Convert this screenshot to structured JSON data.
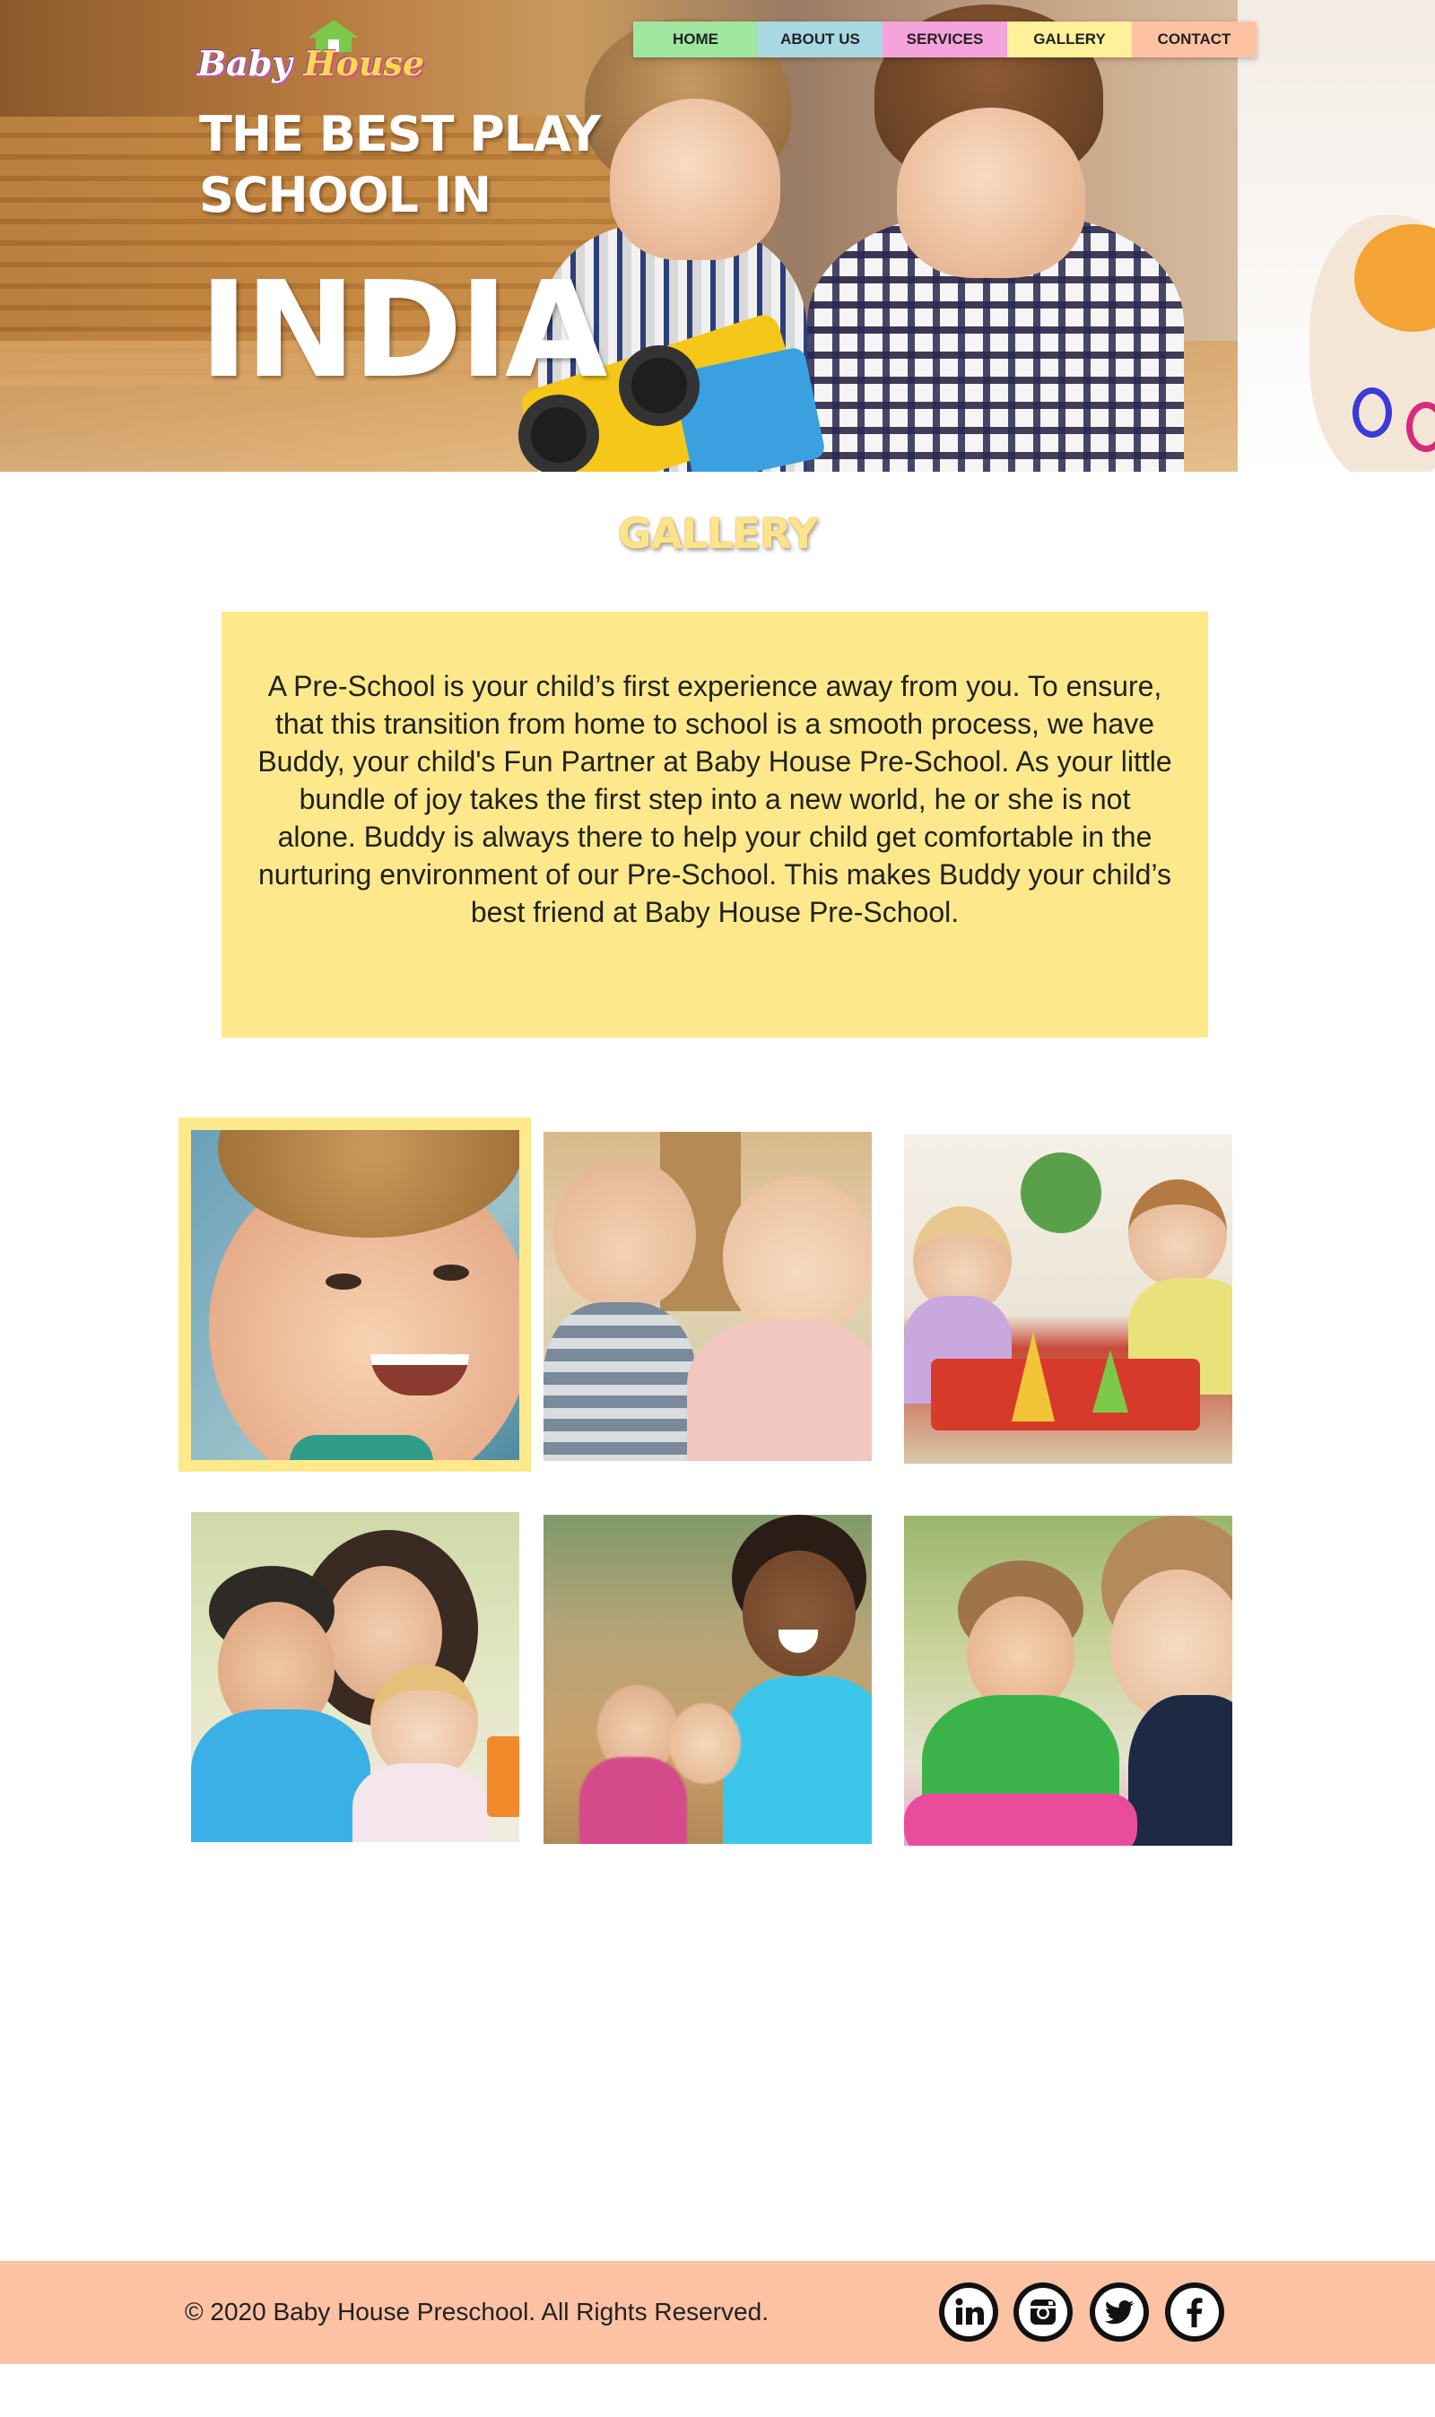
{
  "logo": {
    "word1": "Baby",
    "word2": "House"
  },
  "nav": {
    "items": [
      {
        "label": "HOME"
      },
      {
        "label": "ABOUT US"
      },
      {
        "label": "SERVICES"
      },
      {
        "label": "GALLERY"
      },
      {
        "label": "CONTACT"
      }
    ],
    "colors": [
      "#9fe6a0",
      "#a9d8e2",
      "#f5a3dd",
      "#fff09a",
      "#ffc3a4"
    ]
  },
  "hero": {
    "line1": "THE BEST PLAY",
    "line2": "SCHOOL IN",
    "line3": "INDIA"
  },
  "gallery": {
    "title": "GALLERY",
    "intro": "A Pre-School is your child’s first experience away from you. To ensure, that this transition from home to school is a smooth process, we have Buddy, your child's Fun Partner at Baby House Pre-School. As your little bundle of joy takes the first step into a new world, he or she is not alone. Buddy is always there to help your child get comfortable in the nurturing environment of our Pre-School. This makes Buddy your child’s best friend at Baby House Pre-School."
  },
  "footer": {
    "copyright": "© 2020 Baby House Preschool. All Rights Reserved.",
    "social": [
      "linkedin-icon",
      "instagram-icon",
      "twitter-icon",
      "facebook-icon"
    ]
  },
  "colors": {
    "accent_yellow": "#fde98c",
    "footer_peach": "#fdc1a3"
  }
}
